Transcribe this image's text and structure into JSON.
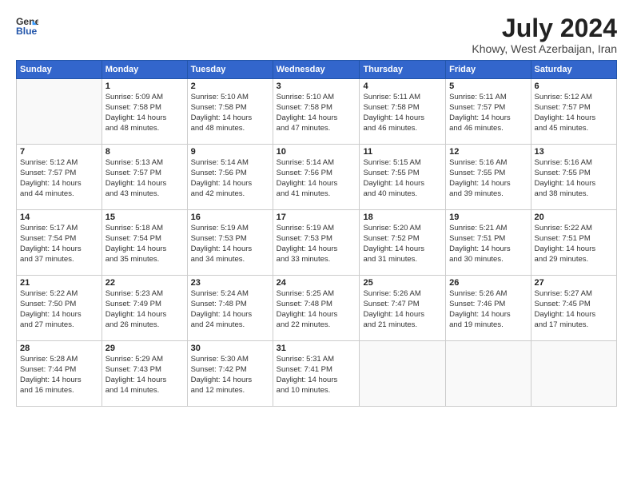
{
  "logo": {
    "line1": "General",
    "line2": "Blue"
  },
  "title": "July 2024",
  "location": "Khowy, West Azerbaijan, Iran",
  "days": [
    "Sunday",
    "Monday",
    "Tuesday",
    "Wednesday",
    "Thursday",
    "Friday",
    "Saturday"
  ],
  "weeks": [
    [
      {
        "date": "",
        "info": ""
      },
      {
        "date": "1",
        "info": "Sunrise: 5:09 AM\nSunset: 7:58 PM\nDaylight: 14 hours\nand 48 minutes."
      },
      {
        "date": "2",
        "info": "Sunrise: 5:10 AM\nSunset: 7:58 PM\nDaylight: 14 hours\nand 48 minutes."
      },
      {
        "date": "3",
        "info": "Sunrise: 5:10 AM\nSunset: 7:58 PM\nDaylight: 14 hours\nand 47 minutes."
      },
      {
        "date": "4",
        "info": "Sunrise: 5:11 AM\nSunset: 7:58 PM\nDaylight: 14 hours\nand 46 minutes."
      },
      {
        "date": "5",
        "info": "Sunrise: 5:11 AM\nSunset: 7:57 PM\nDaylight: 14 hours\nand 46 minutes."
      },
      {
        "date": "6",
        "info": "Sunrise: 5:12 AM\nSunset: 7:57 PM\nDaylight: 14 hours\nand 45 minutes."
      }
    ],
    [
      {
        "date": "7",
        "info": "Sunrise: 5:12 AM\nSunset: 7:57 PM\nDaylight: 14 hours\nand 44 minutes."
      },
      {
        "date": "8",
        "info": "Sunrise: 5:13 AM\nSunset: 7:57 PM\nDaylight: 14 hours\nand 43 minutes."
      },
      {
        "date": "9",
        "info": "Sunrise: 5:14 AM\nSunset: 7:56 PM\nDaylight: 14 hours\nand 42 minutes."
      },
      {
        "date": "10",
        "info": "Sunrise: 5:14 AM\nSunset: 7:56 PM\nDaylight: 14 hours\nand 41 minutes."
      },
      {
        "date": "11",
        "info": "Sunrise: 5:15 AM\nSunset: 7:55 PM\nDaylight: 14 hours\nand 40 minutes."
      },
      {
        "date": "12",
        "info": "Sunrise: 5:16 AM\nSunset: 7:55 PM\nDaylight: 14 hours\nand 39 minutes."
      },
      {
        "date": "13",
        "info": "Sunrise: 5:16 AM\nSunset: 7:55 PM\nDaylight: 14 hours\nand 38 minutes."
      }
    ],
    [
      {
        "date": "14",
        "info": "Sunrise: 5:17 AM\nSunset: 7:54 PM\nDaylight: 14 hours\nand 37 minutes."
      },
      {
        "date": "15",
        "info": "Sunrise: 5:18 AM\nSunset: 7:54 PM\nDaylight: 14 hours\nand 35 minutes."
      },
      {
        "date": "16",
        "info": "Sunrise: 5:19 AM\nSunset: 7:53 PM\nDaylight: 14 hours\nand 34 minutes."
      },
      {
        "date": "17",
        "info": "Sunrise: 5:19 AM\nSunset: 7:53 PM\nDaylight: 14 hours\nand 33 minutes."
      },
      {
        "date": "18",
        "info": "Sunrise: 5:20 AM\nSunset: 7:52 PM\nDaylight: 14 hours\nand 31 minutes."
      },
      {
        "date": "19",
        "info": "Sunrise: 5:21 AM\nSunset: 7:51 PM\nDaylight: 14 hours\nand 30 minutes."
      },
      {
        "date": "20",
        "info": "Sunrise: 5:22 AM\nSunset: 7:51 PM\nDaylight: 14 hours\nand 29 minutes."
      }
    ],
    [
      {
        "date": "21",
        "info": "Sunrise: 5:22 AM\nSunset: 7:50 PM\nDaylight: 14 hours\nand 27 minutes."
      },
      {
        "date": "22",
        "info": "Sunrise: 5:23 AM\nSunset: 7:49 PM\nDaylight: 14 hours\nand 26 minutes."
      },
      {
        "date": "23",
        "info": "Sunrise: 5:24 AM\nSunset: 7:48 PM\nDaylight: 14 hours\nand 24 minutes."
      },
      {
        "date": "24",
        "info": "Sunrise: 5:25 AM\nSunset: 7:48 PM\nDaylight: 14 hours\nand 22 minutes."
      },
      {
        "date": "25",
        "info": "Sunrise: 5:26 AM\nSunset: 7:47 PM\nDaylight: 14 hours\nand 21 minutes."
      },
      {
        "date": "26",
        "info": "Sunrise: 5:26 AM\nSunset: 7:46 PM\nDaylight: 14 hours\nand 19 minutes."
      },
      {
        "date": "27",
        "info": "Sunrise: 5:27 AM\nSunset: 7:45 PM\nDaylight: 14 hours\nand 17 minutes."
      }
    ],
    [
      {
        "date": "28",
        "info": "Sunrise: 5:28 AM\nSunset: 7:44 PM\nDaylight: 14 hours\nand 16 minutes."
      },
      {
        "date": "29",
        "info": "Sunrise: 5:29 AM\nSunset: 7:43 PM\nDaylight: 14 hours\nand 14 minutes."
      },
      {
        "date": "30",
        "info": "Sunrise: 5:30 AM\nSunset: 7:42 PM\nDaylight: 14 hours\nand 12 minutes."
      },
      {
        "date": "31",
        "info": "Sunrise: 5:31 AM\nSunset: 7:41 PM\nDaylight: 14 hours\nand 10 minutes."
      },
      {
        "date": "",
        "info": ""
      },
      {
        "date": "",
        "info": ""
      },
      {
        "date": "",
        "info": ""
      }
    ]
  ]
}
